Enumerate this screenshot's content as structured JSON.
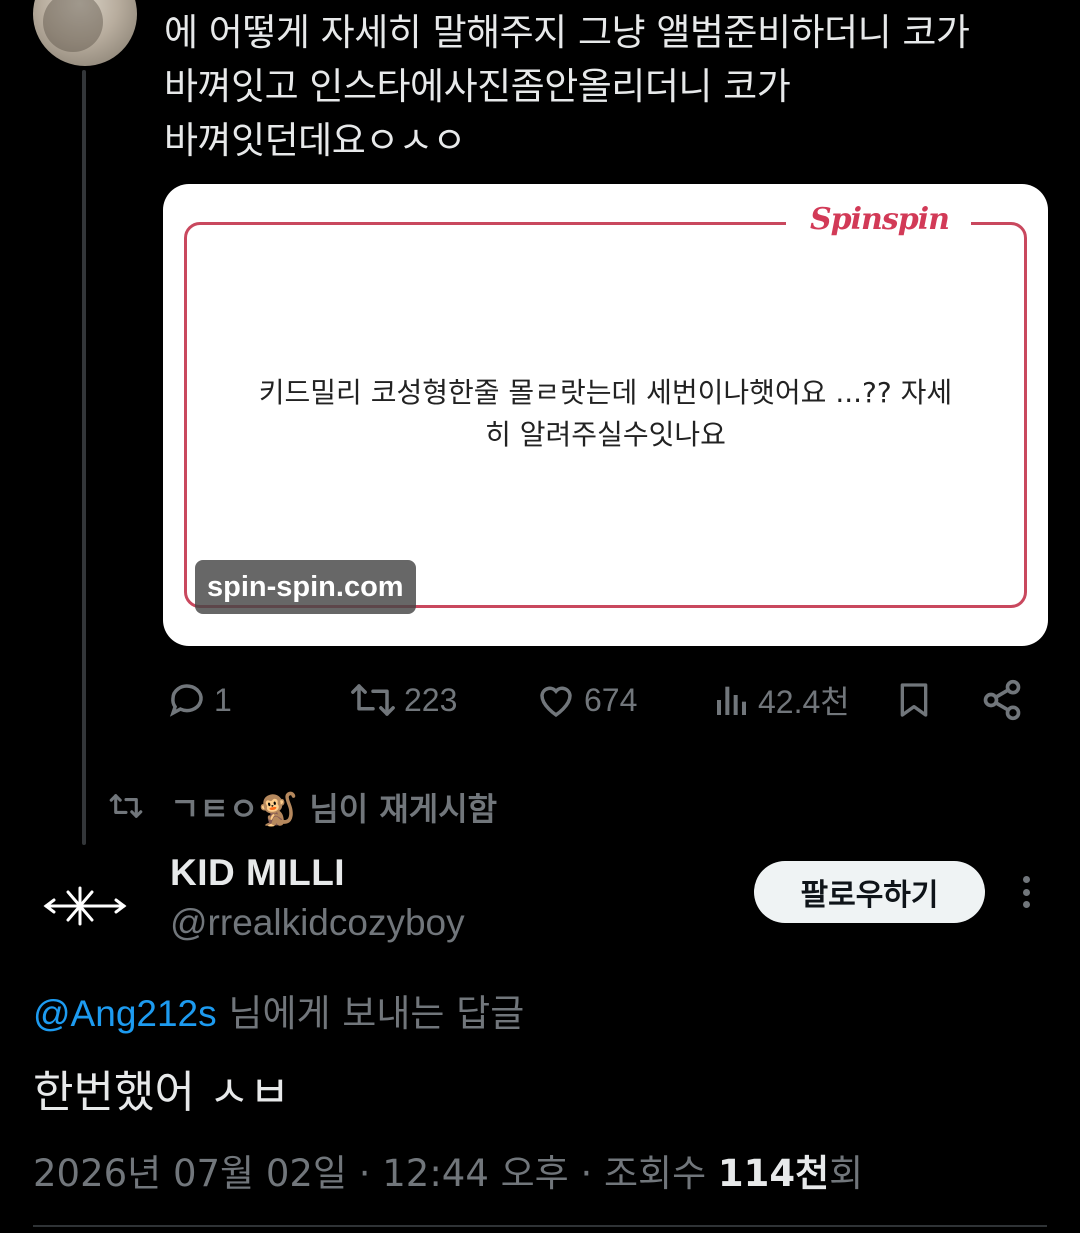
{
  "quoted_tweet": {
    "text_lines": [
      "에 어떻게 자세히 말해주지 그냥 앨범준비하더니 코가",
      "바껴잇고 인스타에사진좀안올리더니 코가",
      "바껴잇던데요ㅇㅅㅇ"
    ],
    "media": {
      "brand": "Spinspin",
      "quote_lines": [
        "키드밀리 코성형한줄 몰ㄹ랏는데 세번이나햇어요 ...?? 자세",
        "히 알려주실수잇나요"
      ],
      "watermark": "spin-spin.com"
    },
    "actions": {
      "replies": "1",
      "retweets": "223",
      "likes": "674",
      "views": "42.4천"
    }
  },
  "retweet_header": {
    "label_prefix": "ㄱㅌㅇ",
    "label_emoji": "🐒",
    "label_suffix": " 님이 재게시함"
  },
  "main_tweet": {
    "display_name": "KID MILLI",
    "handle": "@rrealkidcozyboy",
    "follow_label": "팔로우하기",
    "reply_mention": "@Ang212s",
    "reply_suffix": " 님에게 보내는 답글",
    "body": "한번했어 ㅅㅂ",
    "timestamp": "2026년 07월 02일 · 12:44 오후 · 조회수 ",
    "views_count": "114천",
    "views_suffix": "회"
  },
  "colors": {
    "background": "#000000",
    "text_primary": "#e7e9ea",
    "text_secondary": "#71767b",
    "link": "#1d9bf0",
    "brand_pink": "#d23a57"
  }
}
